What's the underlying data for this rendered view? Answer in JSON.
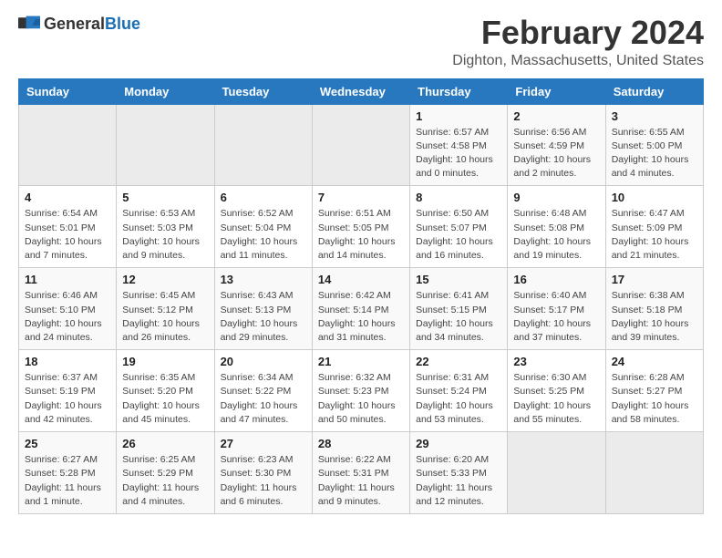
{
  "logo": {
    "general": "General",
    "blue": "Blue"
  },
  "title": "February 2024",
  "subtitle": "Dighton, Massachusetts, United States",
  "headers": [
    "Sunday",
    "Monday",
    "Tuesday",
    "Wednesday",
    "Thursday",
    "Friday",
    "Saturday"
  ],
  "weeks": [
    [
      {
        "day": "",
        "info": ""
      },
      {
        "day": "",
        "info": ""
      },
      {
        "day": "",
        "info": ""
      },
      {
        "day": "",
        "info": ""
      },
      {
        "day": "1",
        "info": "Sunrise: 6:57 AM\nSunset: 4:58 PM\nDaylight: 10 hours\nand 0 minutes."
      },
      {
        "day": "2",
        "info": "Sunrise: 6:56 AM\nSunset: 4:59 PM\nDaylight: 10 hours\nand 2 minutes."
      },
      {
        "day": "3",
        "info": "Sunrise: 6:55 AM\nSunset: 5:00 PM\nDaylight: 10 hours\nand 4 minutes."
      }
    ],
    [
      {
        "day": "4",
        "info": "Sunrise: 6:54 AM\nSunset: 5:01 PM\nDaylight: 10 hours\nand 7 minutes."
      },
      {
        "day": "5",
        "info": "Sunrise: 6:53 AM\nSunset: 5:03 PM\nDaylight: 10 hours\nand 9 minutes."
      },
      {
        "day": "6",
        "info": "Sunrise: 6:52 AM\nSunset: 5:04 PM\nDaylight: 10 hours\nand 11 minutes."
      },
      {
        "day": "7",
        "info": "Sunrise: 6:51 AM\nSunset: 5:05 PM\nDaylight: 10 hours\nand 14 minutes."
      },
      {
        "day": "8",
        "info": "Sunrise: 6:50 AM\nSunset: 5:07 PM\nDaylight: 10 hours\nand 16 minutes."
      },
      {
        "day": "9",
        "info": "Sunrise: 6:48 AM\nSunset: 5:08 PM\nDaylight: 10 hours\nand 19 minutes."
      },
      {
        "day": "10",
        "info": "Sunrise: 6:47 AM\nSunset: 5:09 PM\nDaylight: 10 hours\nand 21 minutes."
      }
    ],
    [
      {
        "day": "11",
        "info": "Sunrise: 6:46 AM\nSunset: 5:10 PM\nDaylight: 10 hours\nand 24 minutes."
      },
      {
        "day": "12",
        "info": "Sunrise: 6:45 AM\nSunset: 5:12 PM\nDaylight: 10 hours\nand 26 minutes."
      },
      {
        "day": "13",
        "info": "Sunrise: 6:43 AM\nSunset: 5:13 PM\nDaylight: 10 hours\nand 29 minutes."
      },
      {
        "day": "14",
        "info": "Sunrise: 6:42 AM\nSunset: 5:14 PM\nDaylight: 10 hours\nand 31 minutes."
      },
      {
        "day": "15",
        "info": "Sunrise: 6:41 AM\nSunset: 5:15 PM\nDaylight: 10 hours\nand 34 minutes."
      },
      {
        "day": "16",
        "info": "Sunrise: 6:40 AM\nSunset: 5:17 PM\nDaylight: 10 hours\nand 37 minutes."
      },
      {
        "day": "17",
        "info": "Sunrise: 6:38 AM\nSunset: 5:18 PM\nDaylight: 10 hours\nand 39 minutes."
      }
    ],
    [
      {
        "day": "18",
        "info": "Sunrise: 6:37 AM\nSunset: 5:19 PM\nDaylight: 10 hours\nand 42 minutes."
      },
      {
        "day": "19",
        "info": "Sunrise: 6:35 AM\nSunset: 5:20 PM\nDaylight: 10 hours\nand 45 minutes."
      },
      {
        "day": "20",
        "info": "Sunrise: 6:34 AM\nSunset: 5:22 PM\nDaylight: 10 hours\nand 47 minutes."
      },
      {
        "day": "21",
        "info": "Sunrise: 6:32 AM\nSunset: 5:23 PM\nDaylight: 10 hours\nand 50 minutes."
      },
      {
        "day": "22",
        "info": "Sunrise: 6:31 AM\nSunset: 5:24 PM\nDaylight: 10 hours\nand 53 minutes."
      },
      {
        "day": "23",
        "info": "Sunrise: 6:30 AM\nSunset: 5:25 PM\nDaylight: 10 hours\nand 55 minutes."
      },
      {
        "day": "24",
        "info": "Sunrise: 6:28 AM\nSunset: 5:27 PM\nDaylight: 10 hours\nand 58 minutes."
      }
    ],
    [
      {
        "day": "25",
        "info": "Sunrise: 6:27 AM\nSunset: 5:28 PM\nDaylight: 11 hours\nand 1 minute."
      },
      {
        "day": "26",
        "info": "Sunrise: 6:25 AM\nSunset: 5:29 PM\nDaylight: 11 hours\nand 4 minutes."
      },
      {
        "day": "27",
        "info": "Sunrise: 6:23 AM\nSunset: 5:30 PM\nDaylight: 11 hours\nand 6 minutes."
      },
      {
        "day": "28",
        "info": "Sunrise: 6:22 AM\nSunset: 5:31 PM\nDaylight: 11 hours\nand 9 minutes."
      },
      {
        "day": "29",
        "info": "Sunrise: 6:20 AM\nSunset: 5:33 PM\nDaylight: 11 hours\nand 12 minutes."
      },
      {
        "day": "",
        "info": ""
      },
      {
        "day": "",
        "info": ""
      }
    ]
  ]
}
